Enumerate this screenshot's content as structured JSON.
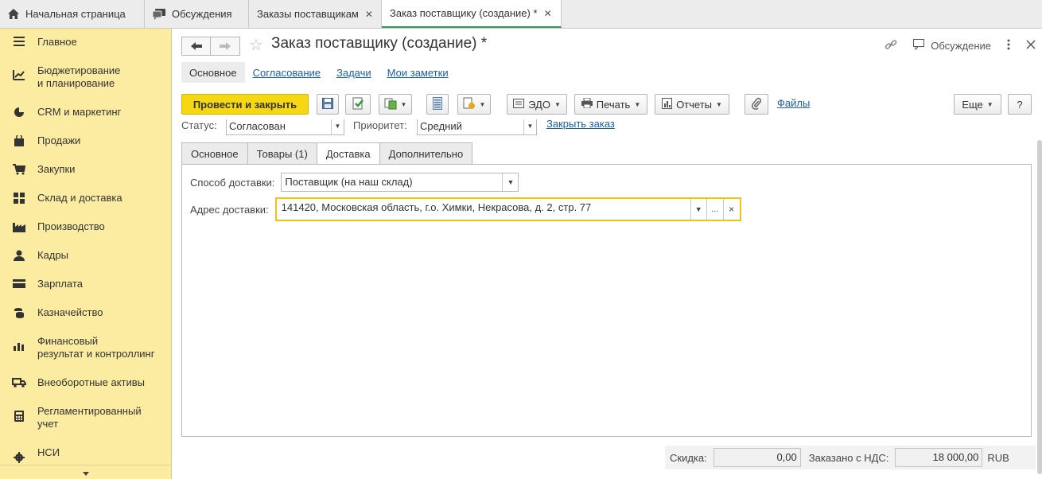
{
  "top_tabs": [
    {
      "label": "Начальная страница",
      "icon": "home-icon"
    },
    {
      "label": "Обсуждения",
      "icon": "discussions-icon"
    },
    {
      "label": "Заказы поставщикам",
      "closable": true
    },
    {
      "label": "Заказ поставщику (создание) *",
      "closable": true,
      "active": true
    }
  ],
  "sidebar": {
    "items": [
      {
        "label": "Главное",
        "icon": "menu-icon"
      },
      {
        "label": "Бюджетирование\nи планирование",
        "icon": "budget-chart-icon"
      },
      {
        "label": "CRM и маркетинг",
        "icon": "pie-chart-icon"
      },
      {
        "label": "Продажи",
        "icon": "shopping-bag-icon"
      },
      {
        "label": "Закупки",
        "icon": "cart-icon"
      },
      {
        "label": "Склад и доставка",
        "icon": "warehouse-grid-icon"
      },
      {
        "label": "Производство",
        "icon": "factory-icon"
      },
      {
        "label": "Кадры",
        "icon": "person-icon"
      },
      {
        "label": "Зарплата",
        "icon": "wallet-icon"
      },
      {
        "label": "Казначейство",
        "icon": "coins-icon"
      },
      {
        "label": "Финансовый\nрезультат и контроллинг",
        "icon": "bar-chart-icon"
      },
      {
        "label": "Внеоборотные активы",
        "icon": "truck-icon"
      },
      {
        "label": "Регламентированный\nучет",
        "icon": "calculator-icon"
      },
      {
        "label": "НСИ",
        "icon": "gear-icon"
      }
    ]
  },
  "header": {
    "title": "Заказ поставщику (создание) *",
    "discussion_label": "Обсуждение"
  },
  "subnav": [
    "Основное",
    "Согласование",
    "Задачи",
    "Мои заметки"
  ],
  "toolbar": {
    "post_close": "Провести и закрыть",
    "edo": "ЭДО",
    "print": "Печать",
    "reports": "Отчеты",
    "files": "Файлы",
    "more": "Еще",
    "help": "?"
  },
  "status": {
    "status_label": "Статус:",
    "status_value": "Согласован",
    "priority_label": "Приоритет:",
    "priority_value": "Средний",
    "close_order": "Закрыть заказ"
  },
  "tabs": [
    "Основное",
    "Товары (1)",
    "Доставка",
    "Дополнительно"
  ],
  "delivery": {
    "method_label": "Способ доставки:",
    "method_value": "Поставщик (на наш склад)",
    "address_label": "Адрес доставки:",
    "address_value": "141420, Московская область, г.о. Химки, Некрасова, д. 2, стр. 77",
    "ellipsis": "...",
    "clear": "×"
  },
  "footer": {
    "discount_label": "Скидка:",
    "discount_value": "0,00",
    "ordered_label": "Заказано с НДС:",
    "ordered_value": "18 000,00",
    "currency": "RUB"
  },
  "colors": {
    "sidebar_bg": "#fbeca2",
    "primary_button": "#f5d714",
    "link": "#1a5fa8",
    "focus_border": "#f2c21a",
    "active_tab_underline": "#2c9c62"
  }
}
